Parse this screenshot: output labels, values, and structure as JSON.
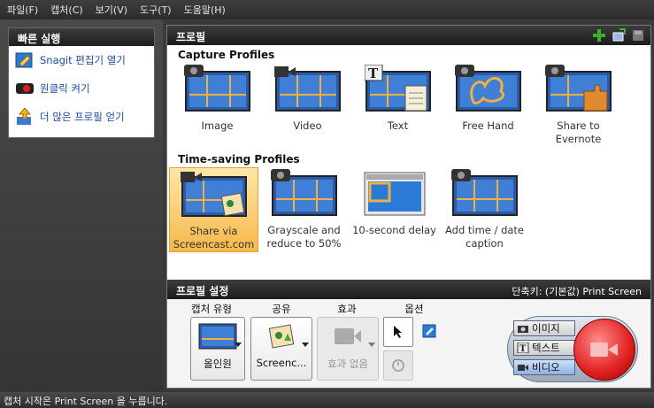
{
  "menu": [
    "파일(F)",
    "캡처(C)",
    "보기(V)",
    "도구(T)",
    "도움말(H)"
  ],
  "quick": {
    "title": "빠른 실행",
    "items": [
      "Snagit 편집기 열기",
      "원클릭 켜기",
      "더 많은 프로필 얻기"
    ]
  },
  "profiles": {
    "title": "프로필",
    "capture_title": "Capture Profiles",
    "capture": [
      "Image",
      "Video",
      "Text",
      "Free Hand",
      "Share to Evernote"
    ],
    "timesaving_title": "Time-saving Profiles",
    "timesaving": [
      {
        "line1": "Share via",
        "line2": "Screencast.com"
      },
      {
        "line1": "Grayscale and",
        "line2": "reduce to 50%"
      },
      {
        "line1": "10-second delay",
        "line2": ""
      },
      {
        "line1": "Add time / date",
        "line2": "caption"
      }
    ]
  },
  "settings": {
    "title": "프로필 설정",
    "hotkey": "단축키: (기본값) Print Screen",
    "labels": {
      "type": "캡처 유형",
      "share": "공유",
      "effect": "효과",
      "options": "옵션"
    },
    "type_value": "올인원",
    "share_value": "Screenc...",
    "effect_value": "효과 없음",
    "modes": [
      "이미지",
      "텍스트",
      "비디오"
    ]
  },
  "status": "캡처 시작은 Print Screen 을 누릅니다.",
  "colors": {
    "accent": "#f6b84a",
    "record": "#e02020",
    "link": "#1a4aa0"
  }
}
